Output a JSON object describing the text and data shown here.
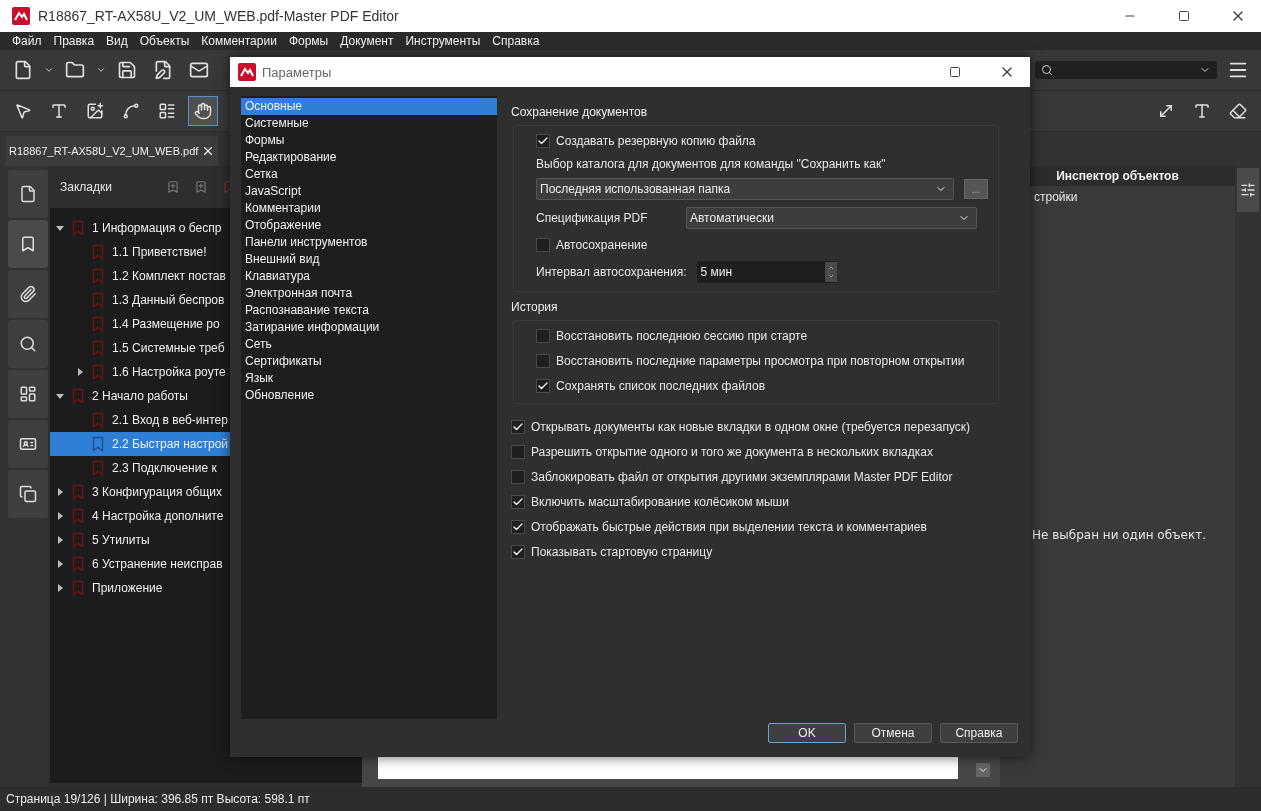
{
  "window": {
    "title": "R18867_RT-AX58U_V2_UM_WEB.pdf-Master PDF Editor"
  },
  "menu": [
    "Файл",
    "Правка",
    "Вид",
    "Объекты",
    "Комментарии",
    "Формы",
    "Документ",
    "Инструменты",
    "Справка"
  ],
  "tools": [
    {
      "kind": "pointer",
      "selected": false
    },
    {
      "kind": "text",
      "selected": false
    },
    {
      "kind": "image",
      "selected": false
    },
    {
      "kind": "shape",
      "selected": false
    },
    {
      "kind": "form",
      "selected": false
    },
    {
      "kind": "hand",
      "selected": true
    }
  ],
  "document_tab": {
    "label": "R18867_RT-AX58U_V2_UM_WEB.pdf"
  },
  "side_tabs": [
    {
      "kind": "page",
      "selected": false
    },
    {
      "kind": "bookmark",
      "selected": true
    },
    {
      "kind": "attachment",
      "selected": false
    },
    {
      "kind": "search",
      "selected": false
    },
    {
      "kind": "layout",
      "selected": false
    },
    {
      "kind": "card",
      "selected": false
    },
    {
      "kind": "copy",
      "selected": false
    }
  ],
  "bookmarks": {
    "title": "Закладки",
    "items": [
      {
        "label": "1 Информация о беспр",
        "kind": "branch",
        "expanded": true,
        "selected": false,
        "children": [
          {
            "label": "1.1 Приветствие!",
            "kind": "leaf",
            "selected": false
          },
          {
            "label": "1.2 Комплект постав",
            "kind": "leaf",
            "selected": false
          },
          {
            "label": "1.3 Данный беспров",
            "kind": "leaf",
            "selected": false
          },
          {
            "label": "1.4 Размещение ро",
            "kind": "leaf",
            "selected": false
          },
          {
            "label": "1.5 Системные треб",
            "kind": "leaf",
            "selected": false
          },
          {
            "label": "1.6 Настройка роуте",
            "kind": "branch",
            "expanded": false,
            "selected": false
          }
        ]
      },
      {
        "label": "2 Начало работы",
        "kind": "branch",
        "expanded": true,
        "selected": false,
        "children": [
          {
            "label": "2.1 Вход в веб-интер",
            "kind": "leaf",
            "selected": false
          },
          {
            "label": "2.2 Быстрая настрой",
            "kind": "leaf",
            "selected": true
          },
          {
            "label": "2.3 Подключение к",
            "kind": "leaf",
            "selected": false
          }
        ]
      },
      {
        "label": "3 Конфигурация общих",
        "kind": "branch",
        "expanded": false,
        "selected": false
      },
      {
        "label": "4 Настройка дополните",
        "kind": "branch",
        "expanded": false,
        "selected": false
      },
      {
        "label": "5 Утилиты",
        "kind": "branch",
        "expanded": false,
        "selected": false
      },
      {
        "label": "6 Устранение неисправ",
        "kind": "branch",
        "expanded": false,
        "selected": false
      },
      {
        "label": "Приложение",
        "kind": "branch",
        "expanded": false,
        "selected": false
      }
    ]
  },
  "inspector": {
    "title": "Инспектор объектов",
    "tab": "стройки",
    "message": "Не выбран ни один объект."
  },
  "dialog": {
    "title": "Параметры",
    "categories": [
      {
        "label": "Основные",
        "selected": true
      },
      {
        "label": "Системные",
        "selected": false
      },
      {
        "label": "Формы",
        "selected": false
      },
      {
        "label": "Редактирование",
        "selected": false
      },
      {
        "label": "Сетка",
        "selected": false
      },
      {
        "label": "JavaScript",
        "selected": false
      },
      {
        "label": "Комментарии",
        "selected": false
      },
      {
        "label": "Отображение",
        "selected": false
      },
      {
        "label": "Панели инструментов",
        "selected": false
      },
      {
        "label": "Внешний вид",
        "selected": false
      },
      {
        "label": "Клавиатура",
        "selected": false
      },
      {
        "label": "Электронная почта",
        "selected": false
      },
      {
        "label": "Распознавание текста",
        "selected": false
      },
      {
        "label": "Затирание информации",
        "selected": false
      },
      {
        "label": "Сеть",
        "selected": false
      },
      {
        "label": "Сертификаты",
        "selected": false
      },
      {
        "label": "Язык",
        "selected": false
      },
      {
        "label": "Обновление",
        "selected": false
      }
    ],
    "saving": {
      "title": "Сохранение документов",
      "backup": {
        "label": "Создавать резервную копию файла",
        "checked": true
      },
      "folder_label": "Выбор каталога для документов для команды \"Сохранить как\"",
      "folder_value": "Последняя использованная папка",
      "browse": "...",
      "pdf_spec_label": "Спецификация PDF",
      "pdf_spec_value": "Автоматически",
      "autosave": {
        "label": "Автосохранение",
        "checked": false
      },
      "interval_label": "Интервал автосохранения:",
      "interval_value": "5 мин"
    },
    "history": {
      "title": "История",
      "options": [
        {
          "label": "Восстановить последнюю сессию при старте",
          "checked": false
        },
        {
          "label": "Восстановить последние параметры просмотра при повторном открытии",
          "checked": false
        },
        {
          "label": "Сохранять список последних файлов",
          "checked": true
        }
      ]
    },
    "options": [
      {
        "label": "Открывать документы как новые вкладки в одном окне (требуется перезапуск)",
        "checked": true
      },
      {
        "label": "Разрешить открытие одного и того же документа в нескольких вкладках",
        "checked": false
      },
      {
        "label": "Заблокировать файл от открытия другими экземплярами Master PDF Editor",
        "checked": false
      },
      {
        "label": "Включить масштабирование колёсиком мыши",
        "checked": true
      },
      {
        "label": "Отображать быстрые действия при выделении текста и комментариев",
        "checked": true
      },
      {
        "label": "Показывать стартовую страницу",
        "checked": true
      }
    ],
    "buttons": [
      {
        "label": "OK",
        "selected": true
      },
      {
        "label": "Отмена",
        "selected": false
      },
      {
        "label": "Справка",
        "selected": false
      }
    ]
  },
  "status_bar": "Страница 19/126 | Ширина: 396.85 пт Высота: 598.1 пт"
}
